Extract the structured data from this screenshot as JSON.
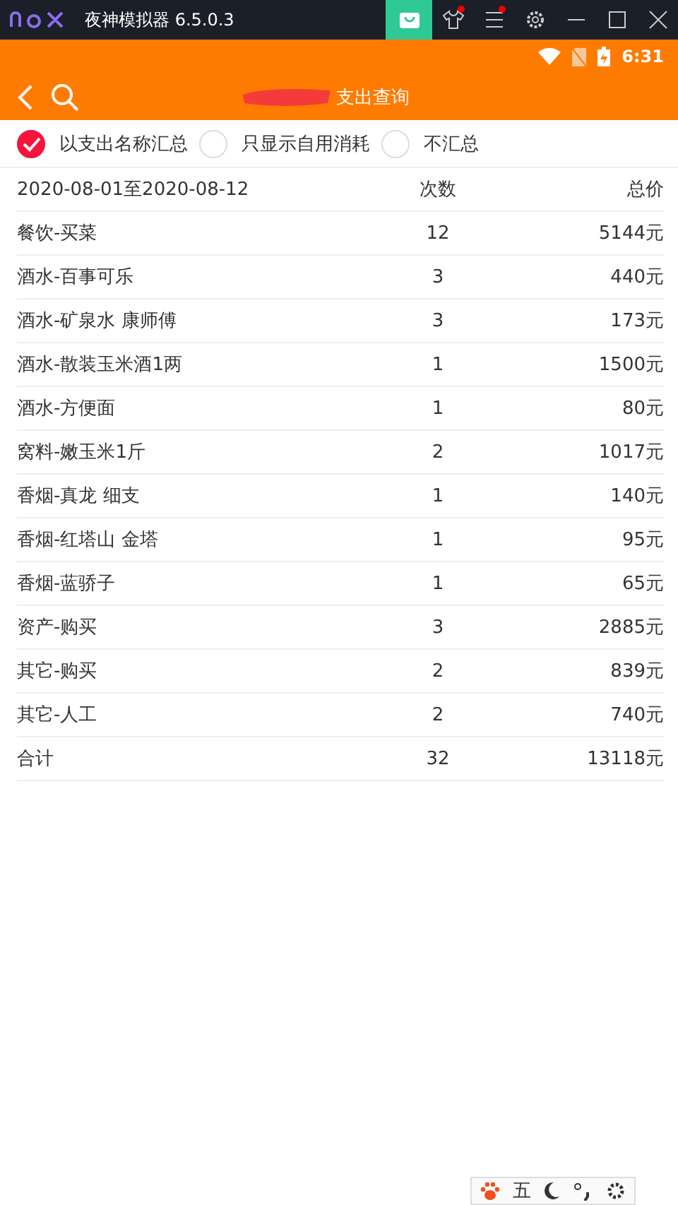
{
  "emulator": {
    "title": "夜神模拟器 6.5.0.3",
    "menu_badges": [
      {
        "kind": "shirt",
        "badge": true
      },
      {
        "kind": "menu",
        "badge": true
      },
      {
        "kind": "gear",
        "badge": false
      }
    ]
  },
  "status_bar": {
    "time": "6:31"
  },
  "app_bar": {
    "title": "支出查询"
  },
  "options": [
    {
      "label": "以支出名称汇总",
      "selected": true
    },
    {
      "label": "只显示自用消耗",
      "selected": false
    },
    {
      "label": "不汇总",
      "selected": false
    }
  ],
  "table": {
    "columns": [
      "2020-08-01至2020-08-12",
      "次数",
      "总价"
    ],
    "rows": [
      [
        "餐饮-买菜",
        "12",
        "5144元"
      ],
      [
        "酒水-百事可乐",
        "3",
        "440元"
      ],
      [
        "酒水-矿泉水 康师傅",
        "3",
        "173元"
      ],
      [
        "酒水-散装玉米酒1两",
        "1",
        "1500元"
      ],
      [
        "酒水-方便面",
        "1",
        "80元"
      ],
      [
        "窝料-嫩玉米1斤",
        "2",
        "1017元"
      ],
      [
        "香烟-真龙 细支",
        "1",
        "140元"
      ],
      [
        "香烟-红塔山 金塔",
        "1",
        "95元"
      ],
      [
        "香烟-蓝骄子",
        "1",
        "65元"
      ],
      [
        "资产-购买",
        "3",
        "2885元"
      ],
      [
        "其它-购买",
        "2",
        "839元"
      ],
      [
        "其它-人工",
        "2",
        "740元"
      ],
      [
        "合计",
        "32",
        "13118元"
      ]
    ]
  },
  "ime_toolbar": {
    "mode": "五"
  }
}
